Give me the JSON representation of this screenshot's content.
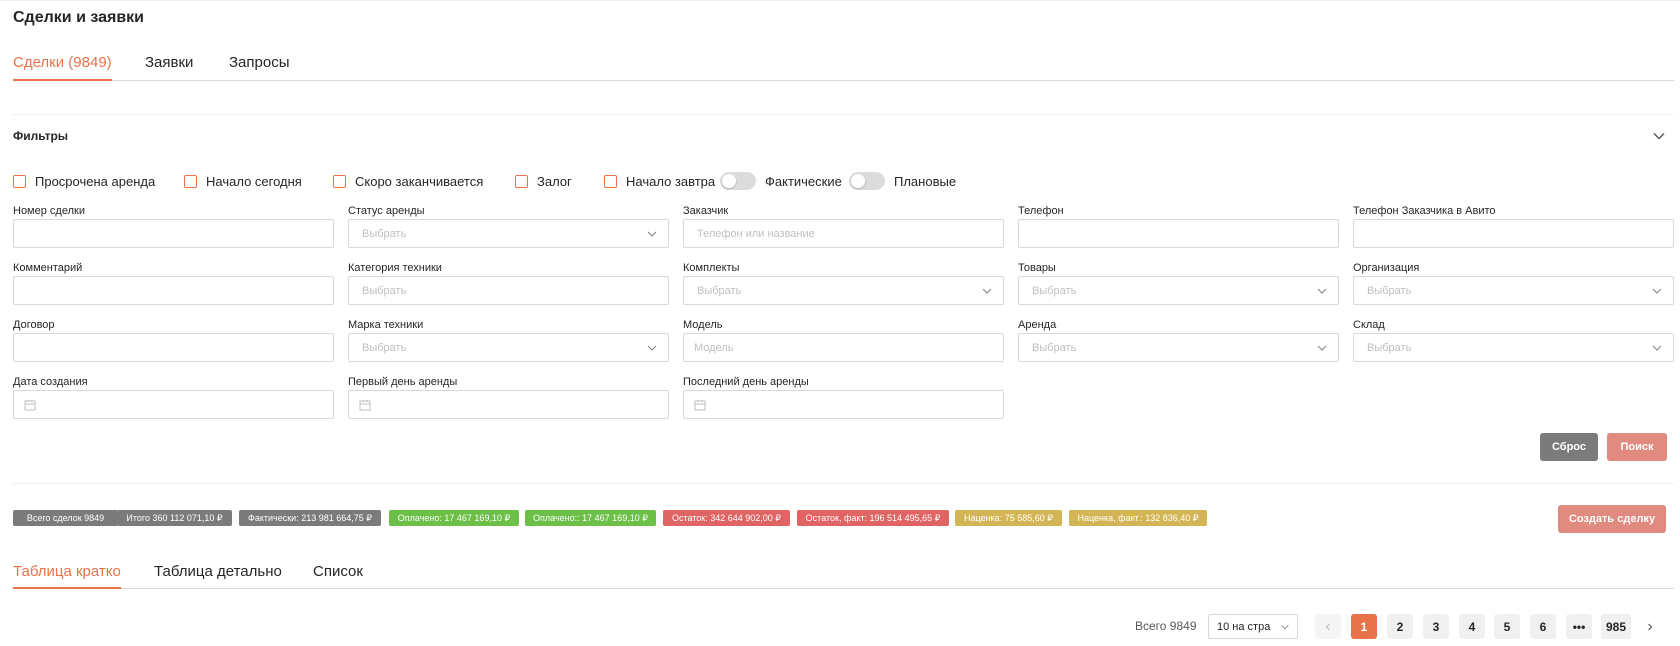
{
  "page": {
    "title": "Сделки и заявки"
  },
  "top_tabs": [
    {
      "label": "Сделки (9849)"
    },
    {
      "label": "Заявки"
    },
    {
      "label": "Запросы"
    }
  ],
  "filters": {
    "title": "Фильтры",
    "checkboxes": [
      {
        "label": "Просрочена аренда"
      },
      {
        "label": "Начало сегодня"
      },
      {
        "label": "Скоро заканчивается"
      },
      {
        "label": "Залог"
      },
      {
        "label": "Начало завтра"
      }
    ],
    "switches": [
      {
        "label": "Фактические",
        "checked": false
      },
      {
        "label": "Плановые",
        "checked": false
      }
    ],
    "fields": [
      {
        "label": "Номер сделки",
        "placeholder": ""
      },
      {
        "label": "Статус аренды",
        "placeholder": "Выбрать"
      },
      {
        "label": "Заказчик",
        "placeholder": "Телефон или название"
      },
      {
        "label": "Телефон",
        "placeholder": ""
      },
      {
        "label": "Телефон Заказчика в Авито",
        "placeholder": ""
      },
      {
        "label": "Комментарий",
        "placeholder": ""
      },
      {
        "label": "Категория техники",
        "placeholder": "Выбрать"
      },
      {
        "label": "Комплекты",
        "placeholder": "Выбрать"
      },
      {
        "label": "Товары",
        "placeholder": "Выбрать"
      },
      {
        "label": "Организация",
        "placeholder": "Выбрать"
      },
      {
        "label": "Договор",
        "placeholder": ""
      },
      {
        "label": "Марка техники",
        "placeholder": "Выбрать"
      },
      {
        "label": "Модель",
        "placeholder": "Модель"
      },
      {
        "label": "Аренда",
        "placeholder": "Выбрать"
      },
      {
        "label": "Склад",
        "placeholder": "Выбрать"
      },
      {
        "label": "Дата создания",
        "placeholder": ""
      },
      {
        "label": "Первый день аренды",
        "placeholder": ""
      },
      {
        "label": "Последний день аренды",
        "placeholder": ""
      }
    ],
    "reset_label": "Сброс",
    "search_label": "Поиск"
  },
  "badges": [
    {
      "text": "Всего сделок 9849",
      "color": "#7b7b7b"
    },
    {
      "text": "Итого 360 112 071,10 ₽",
      "color": "#7b7b7b"
    },
    {
      "text": "Фактически: 213 981 664,75 ₽",
      "color": "#7b7b7b"
    },
    {
      "text": "Оплачено: 17 467 169,10 ₽",
      "color": "#6cbf47"
    },
    {
      "text": "Оплачено:: 17 467 169,10 ₽",
      "color": "#6cbf47"
    },
    {
      "text": "Остаток: 342 644 902,00 ₽",
      "color": "#e06464"
    },
    {
      "text": "Остаток, факт: 196 514 495,65 ₽",
      "color": "#e06464"
    },
    {
      "text": "Наценка: 75 585,60 ₽",
      "color": "#d4b556"
    },
    {
      "text": "Наценка, факт.: 132 836,40 ₽",
      "color": "#d4b556"
    }
  ],
  "create_label": "Создать сделку",
  "view_tabs": [
    {
      "label": "Таблица кратко"
    },
    {
      "label": "Таблица детально"
    },
    {
      "label": "Список"
    }
  ],
  "pagination": {
    "total_text": "Всего 9849",
    "page_size": "10 на стра",
    "pages": [
      "1",
      "2",
      "3",
      "4",
      "5",
      "6",
      "•••",
      "985"
    ],
    "current": "1"
  },
  "colors": {
    "accent": "#e8734a",
    "reset": "#7b7b7b",
    "primary": "#e08a80"
  }
}
